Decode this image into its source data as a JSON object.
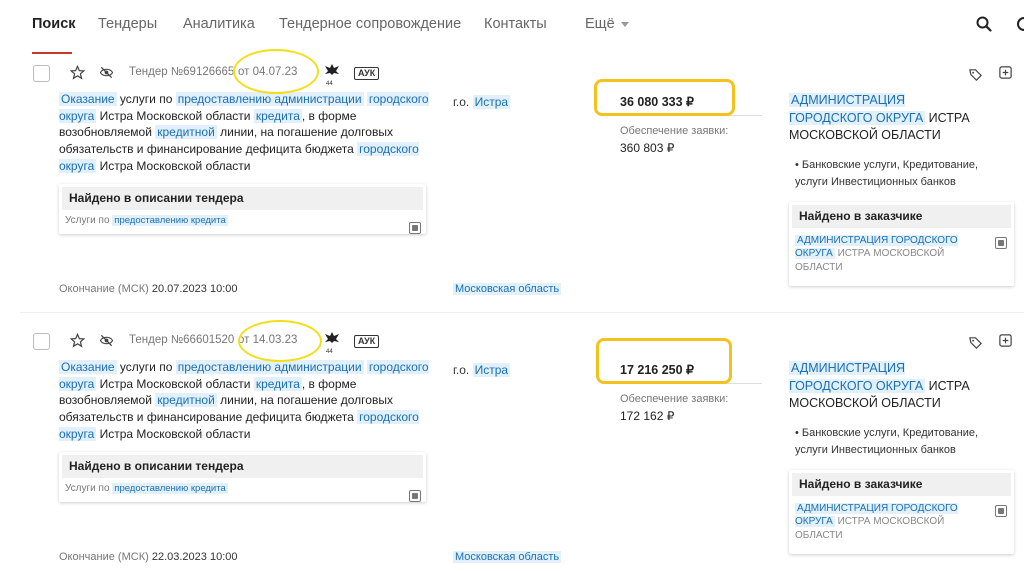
{
  "nav": {
    "items": [
      "Поиск",
      "Тендеры",
      "Аналитика",
      "Тендерное сопровождение",
      "Контакты",
      "Ещё"
    ]
  },
  "tenders": [
    {
      "number": "Тендер №69126665",
      "date": "от 04.07.23",
      "type_badge": "АУК",
      "emblem_number": "44",
      "desc": [
        "Оказание",
        " услуги по ",
        "предоставлению администрации",
        " ",
        "городского округа",
        " Истра Московской области ",
        "кредита",
        ", в форме возобновляемой ",
        "кредитной",
        " линии, на погашение долговых обязательств и финансирование дефицита бюджета ",
        "городского округа",
        " Истра Московской области"
      ],
      "found_title": "Найдено в описании тендера",
      "found_prefix": "Услуги по ",
      "found_highlight": "предоставлению кредита",
      "place_prefix": "г.о.",
      "place": "Истра",
      "price": "36 080 333 ₽",
      "security_label": "Обеспечение заявки:",
      "security_value": "360 803 ₽",
      "customer_highlight": "АДМИНИСТРАЦИЯ ГОРОДСКОГО ОКРУГА",
      "customer_rest": " ИСТРА МОСКОВСКОЙ ОБЛАСТИ",
      "categories": "Банковские услуги, Кредитование, услуги Инвестиционных банков",
      "customer_found_title": "Найдено в заказчике",
      "customer_found_highlight": "АДМИНИСТРАЦИЯ ГОРОДСКОГО ОКРУГА",
      "customer_found_rest": " ИСТРА МОСКОВСКОЙ ОБЛАСТИ",
      "deadline_label": "Окончание (МСК)",
      "deadline": "20.07.2023 10:00",
      "region": "Московская область"
    },
    {
      "number": "Тендер №66601520",
      "date": "от 14.03.23",
      "type_badge": "АУК",
      "emblem_number": "44",
      "desc": [
        "Оказание",
        " услуги по ",
        "предоставлению администрации",
        " ",
        "городского округа",
        " Истра Московской области ",
        "кредита",
        ", в форме возобновляемой ",
        "кредитной",
        " линии, на погашение долговых обязательств и финансирование дефицита бюджета ",
        "городского округа",
        " Истра Московской области"
      ],
      "found_title": "Найдено в описании тендера",
      "found_prefix": "Услуги по ",
      "found_highlight": "предоставлению кредита",
      "place_prefix": "г.о.",
      "place": "Истра",
      "price": "17 216 250 ₽",
      "security_label": "Обеспечение заявки:",
      "security_value": "172 162 ₽",
      "customer_highlight": "АДМИНИСТРАЦИЯ ГОРОДСКОГО ОКРУГА",
      "customer_rest": " ИСТРА МОСКОВСКОЙ ОБЛАСТИ",
      "categories": "Банковские услуги, Кредитование, услуги Инвестиционных банков",
      "customer_found_title": "Найдено в заказчике",
      "customer_found_highlight": "АДМИНИСТРАЦИЯ ГОРОДСКОГО ОКРУГА",
      "customer_found_rest": " ИСТРА МОСКОВСКОЙ ОБЛАСТИ",
      "deadline_label": "Окончание (МСК)",
      "deadline": "22.03.2023 10:00",
      "region": "Московская область"
    }
  ],
  "colors": {
    "highlight_bg": "#e1f0fb",
    "highlight_text": "#1a6fb5",
    "active_underline": "#c0392b",
    "annotation_yellow": "#f4c21f"
  }
}
